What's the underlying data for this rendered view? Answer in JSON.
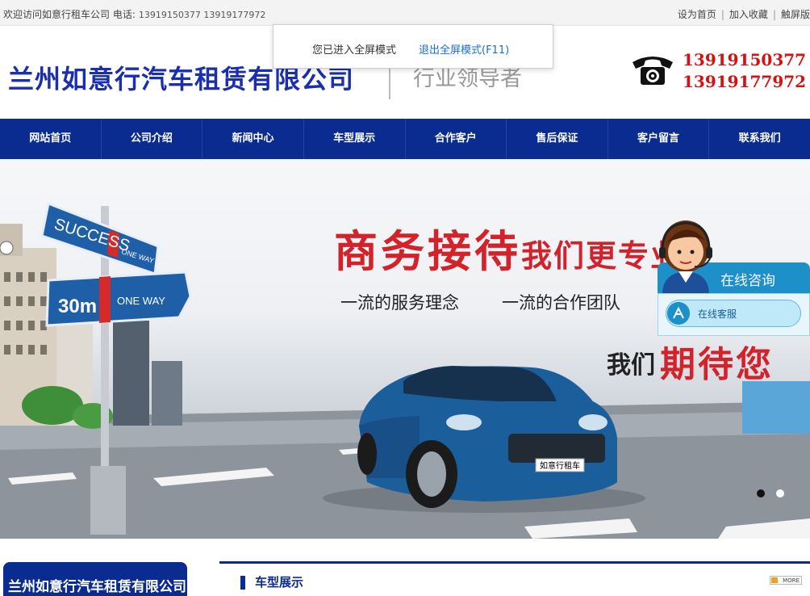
{
  "topbar": {
    "welcome": "欢迎访问如意行租车公司 电话:",
    "phones": "13919150377 13919177972",
    "links": [
      "设为首页",
      "加入收藏",
      "触屏版"
    ]
  },
  "fullscreen_notice": {
    "message": "您已进入全屏模式",
    "exit_label": "退出全屏模式(F11)"
  },
  "header": {
    "company_name": "兰州如意行汽车租赁有限公司",
    "slogan": "行业领导者",
    "hotline": [
      "13919150377",
      "13919177972"
    ],
    "phone_icon": "telephone-icon"
  },
  "nav": {
    "items": [
      "网站首页",
      "公司介绍",
      "新闻中心",
      "车型展示",
      "合作客户",
      "售后保证",
      "客户留言",
      "联系我们"
    ]
  },
  "banner": {
    "headline_big": "商务接待",
    "headline_small": "我们更专业!",
    "sub1": "一流的服务理念",
    "sub2": "一流的合作团队",
    "wait_small": "我们",
    "wait_big": "期待您",
    "sign_success": "SUCCESS",
    "sign_one_way_small": "ONE WAY",
    "sign_30m": "30m",
    "sign_one_way": "ONE WAY",
    "license_plate": "如意行租车",
    "slides_total": 2,
    "active_slide": 1
  },
  "chat_widget": {
    "title": "在线咨询",
    "service_label": "在线客服",
    "colors": {
      "header": "#1d8fc9",
      "body": "#e8f6fc"
    }
  },
  "left_section": {
    "title": "兰州如意行汽车租赁有限公司"
  },
  "main_section": {
    "title": "车型展示",
    "more_label": "MORE"
  },
  "colors": {
    "brand_blue": "#0a2b8f",
    "hotline_red": "#d41212",
    "banner_red": "#d4222a"
  }
}
